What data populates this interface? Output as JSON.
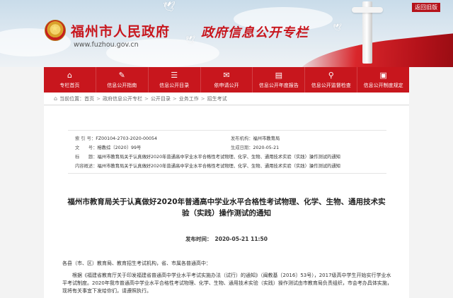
{
  "header": {
    "site_title": "福州市人民政府",
    "site_url": "www.fuzhou.gov.cn",
    "column_title": "政府信息公开专栏",
    "back_link": "返回旧版"
  },
  "nav": {
    "items": [
      {
        "icon": "home-icon",
        "label": "专栏首页"
      },
      {
        "icon": "guide-icon",
        "label": "信息公开指南"
      },
      {
        "icon": "catalog-icon",
        "label": "信息公开目录"
      },
      {
        "icon": "apply-icon",
        "label": "依申请公开"
      },
      {
        "icon": "report-icon",
        "label": "信息公开年度报告"
      },
      {
        "icon": "supervise-icon",
        "label": "信息公开监督检查"
      },
      {
        "icon": "rules-icon",
        "label": "信息公开制度规定"
      }
    ]
  },
  "breadcrumb": {
    "prefix": "当前位置：",
    "items": [
      "首页",
      "政府信息公开专栏",
      "公开目录",
      "业务工作",
      "招生考试"
    ]
  },
  "meta": {
    "index_key": "索 引 号：",
    "index_val": "FZ00104-2703-2020-00054",
    "publisher_key": "发布机构：",
    "publisher_val": "福州市教育局",
    "docno_key": "文　　号：",
    "docno_val": "榕教综〔2020〕99号",
    "date_key": "生成日期：",
    "date_val": "2020-05-21",
    "title_key": "标　　题：",
    "title_val": "福州市教育局关于认真做好2020年普通高中学业水平合格性考试物理、化学、生物、通用技术实验（实践）操作测试的通知",
    "summary_key": "内容概述：",
    "summary_val": "福州市教育局关于认真做好2020年普通高中学业水平合格性考试物理、化学、生物、通用技术实验（实践）操作测试的通知"
  },
  "document": {
    "title": "福州市教育局关于认真做好2020年普通高中学业水平合格性考试物理、化学、生物、通用技术实验（实践）操作测试的通知",
    "pub_label": "发布时间：",
    "pub_time": "2020-05-21 11:50",
    "salutation": "各县（市、区）教育局、教育招生考试机构，省、市属各普通高中：",
    "paragraph1": "根据《福建省教育厅关于印发福建省普通高中学业水平考试实施办法（试行）的通知》（闽教基〔2016〕53号），2017级高中学生开始实行学业水平考试制度。2020年我市普通高中学业水平合格性考试物理、化学、生物、通用技术实验（实践）操作测试由市教育局负责组织，市会考办具体实施，现将有关事宜下发给你们，请遵照执行。"
  }
}
